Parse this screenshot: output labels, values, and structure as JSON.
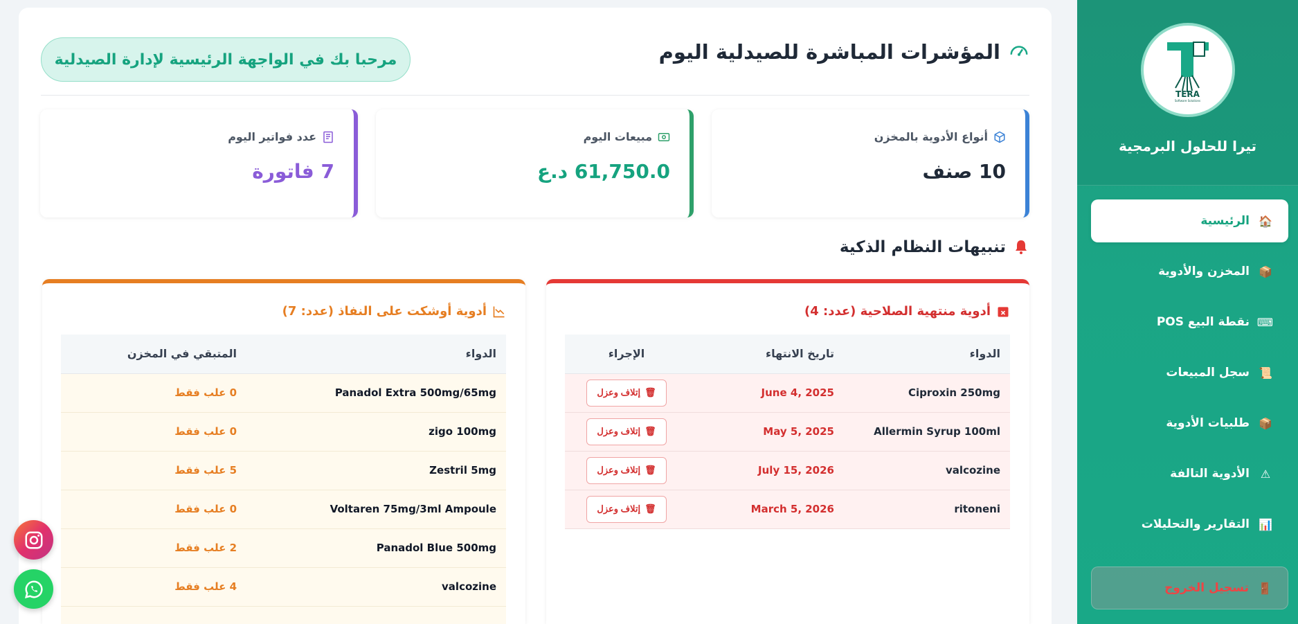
{
  "sidebar": {
    "brand_name": "تيرا للحلول البرمجية",
    "logo_text": "TERA",
    "logo_sub": "Software Solutions",
    "items": [
      {
        "label": "الرئيسية",
        "icon": "house-icon",
        "glyph": "🏠"
      },
      {
        "label": "المخزن والأدوية",
        "icon": "package-icon",
        "glyph": "📦"
      },
      {
        "label": "نقطة البيع POS",
        "icon": "keyboard-icon",
        "glyph": "⌨"
      },
      {
        "label": "سجل المبيعات",
        "icon": "scroll-icon",
        "glyph": "📜"
      },
      {
        "label": "طلبيات الأدوية",
        "icon": "package-icon",
        "glyph": "📦"
      },
      {
        "label": "الأدوية التالفة",
        "icon": "warning-icon",
        "glyph": "⚠"
      },
      {
        "label": "التقارير والتحليلات",
        "icon": "bar-chart-icon",
        "glyph": "📊"
      }
    ],
    "logout_label": "تسجيل الخروج",
    "logout_glyph": "🚪"
  },
  "header": {
    "title": "المؤشرات المباشرة للصيدلية اليوم",
    "welcome": "مرحبا بك في الواجهة الرئيسية لإدارة الصيدلية"
  },
  "stats": [
    {
      "label": "أنواع الأدوية بالمخزن",
      "value": "10 صنف",
      "icon": "box-icon",
      "color": "#3b82d6"
    },
    {
      "label": "مبيعات اليوم",
      "value": "61,750.0 د.ع",
      "icon": "cash-icon",
      "color": "#2ea06a"
    },
    {
      "label": "عدد فواتير اليوم",
      "value": "7 فاتورة",
      "icon": "receipt-icon",
      "color": "#8a5cd8"
    }
  ],
  "alerts": {
    "title": "تنبيهات النظام الذكية",
    "expired": {
      "title": "أدوية منتهية الصلاحية (عدد: 4)",
      "headers": [
        "الدواء",
        "تاريخ الانتهاء",
        "الإجراء"
      ],
      "action_label": "إتلاف وعزل",
      "rows": [
        {
          "drug": "Ciproxin 250mg",
          "date": "June 4, 2025"
        },
        {
          "drug": "Allermin Syrup 100ml",
          "date": "May 5, 2025"
        },
        {
          "drug": "valcozine",
          "date": "July 15, 2026"
        },
        {
          "drug": "ritoneni",
          "date": "March 5, 2026"
        }
      ]
    },
    "low_stock": {
      "title": "أدوية أوشكت على النفاذ (عدد: 7)",
      "headers": [
        "الدواء",
        "المتبقي في المخزن"
      ],
      "rows": [
        {
          "drug": "Panadol Extra 500mg/65mg",
          "qty": "0 علب فقط"
        },
        {
          "drug": "zigo 100mg",
          "qty": "0 علب فقط"
        },
        {
          "drug": "Zestril 5mg",
          "qty": "5 علب فقط"
        },
        {
          "drug": "Voltaren 75mg/3ml Ampoule",
          "qty": "0 علب فقط"
        },
        {
          "drug": "Panadol Blue 500mg",
          "qty": "2 علب فقط"
        },
        {
          "drug": "valcozine",
          "qty": "4 علب فقط"
        }
      ]
    }
  },
  "colors": {
    "brand": "#19a887",
    "danger": "#d32f2f",
    "warning": "#e67e22",
    "purple": "#8a5cd8"
  }
}
